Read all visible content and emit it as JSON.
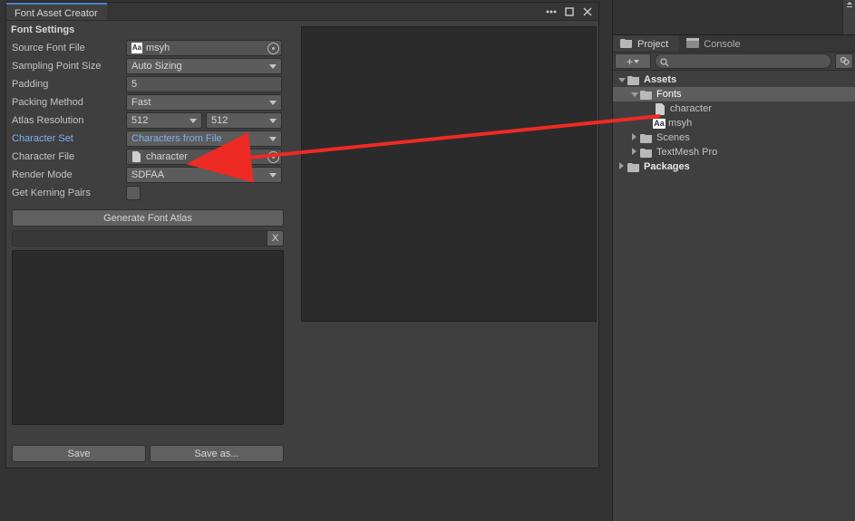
{
  "window": {
    "title": "Font Asset Creator"
  },
  "font_settings": {
    "header": "Font Settings",
    "source_font_label": "Source Font File",
    "source_font_value": "msyh",
    "source_font_badge": "Aa",
    "sampling_label": "Sampling Point Size",
    "sampling_value": "Auto Sizing",
    "padding_label": "Padding",
    "padding_value": "5",
    "packing_label": "Packing Method",
    "packing_value": "Fast",
    "atlas_label": "Atlas Resolution",
    "atlas_w": "512",
    "atlas_h": "512",
    "charset_label": "Character Set",
    "charset_value": "Characters from File",
    "charfile_label": "Character File",
    "charfile_value": "character",
    "render_label": "Render Mode",
    "render_value": "SDFAA",
    "kerning_label": "Get Kerning Pairs",
    "generate_label": "Generate Font Atlas",
    "clear_label": "X",
    "save_label": "Save",
    "save_as_label": "Save as..."
  },
  "project": {
    "tab_project": "Project",
    "tab_console": "Console",
    "tree": {
      "assets": "Assets",
      "fonts": "Fonts",
      "character": "character",
      "msyh": "msyh",
      "msyh_badge": "Aa",
      "scenes": "Scenes",
      "textmesh": "TextMesh Pro",
      "packages": "Packages"
    }
  }
}
